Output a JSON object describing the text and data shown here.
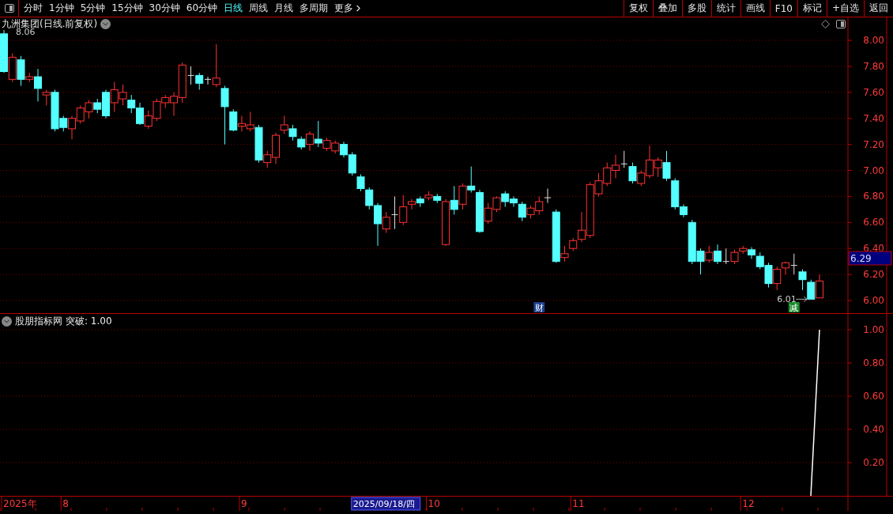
{
  "toolbar": {
    "periods": [
      {
        "label": "分时",
        "selected": false
      },
      {
        "label": "1分钟",
        "selected": false
      },
      {
        "label": "5分钟",
        "selected": false
      },
      {
        "label": "15分钟",
        "selected": false
      },
      {
        "label": "30分钟",
        "selected": false
      },
      {
        "label": "60分钟",
        "selected": false
      },
      {
        "label": "日线",
        "selected": true
      },
      {
        "label": "周线",
        "selected": false
      },
      {
        "label": "月线",
        "selected": false
      },
      {
        "label": "多周期",
        "selected": false
      }
    ],
    "more": "更多",
    "buttons": [
      "复权",
      "叠加",
      "多股",
      "统计",
      "画线",
      "F10",
      "标记",
      "+自选",
      "返回"
    ]
  },
  "price_chart": {
    "title": "九洲集团(日线.前复权)",
    "current_price": "6.29",
    "high_label": "8.06",
    "low_label": "6.01",
    "axis_labels": [
      "8.00",
      "7.80",
      "7.60",
      "7.40",
      "7.20",
      "7.00",
      "6.80",
      "6.60",
      "6.40",
      "6.20",
      "6.00"
    ],
    "events": [
      {
        "text": "财",
        "color": "#1c3f8c"
      },
      {
        "text": "减",
        "color": "#1a8a2a"
      }
    ]
  },
  "indicator": {
    "name": "股朋指标网",
    "reading": "突破: 1.00",
    "axis_labels": [
      "1.00",
      "0.80",
      "0.60",
      "0.40",
      "0.20"
    ]
  },
  "time_axis": {
    "labels": [
      "2025年",
      "8",
      "9",
      "10",
      "11",
      "12"
    ],
    "cursor_date": "2025/09/18/四"
  }
}
